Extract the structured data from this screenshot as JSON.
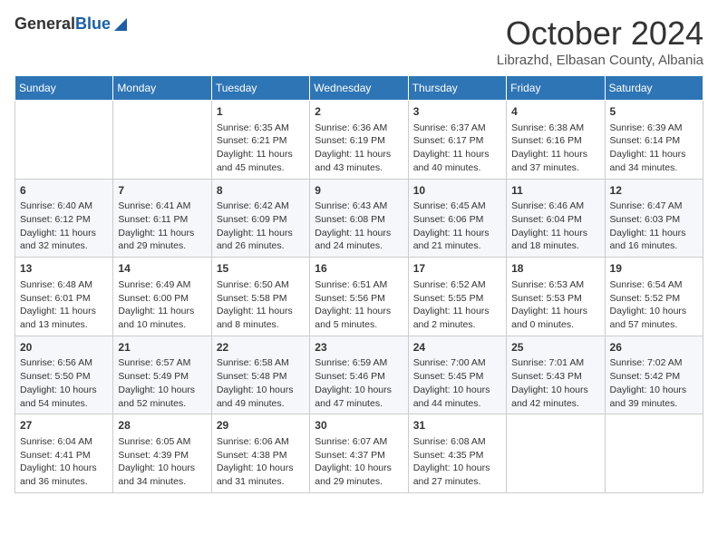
{
  "logo": {
    "general": "General",
    "blue": "Blue"
  },
  "header": {
    "month": "October 2024",
    "location": "Librazhd, Elbasan County, Albania"
  },
  "weekdays": [
    "Sunday",
    "Monday",
    "Tuesday",
    "Wednesday",
    "Thursday",
    "Friday",
    "Saturday"
  ],
  "weeks": [
    [
      {
        "day": null,
        "sunrise": null,
        "sunset": null,
        "daylight": null
      },
      {
        "day": null,
        "sunrise": null,
        "sunset": null,
        "daylight": null
      },
      {
        "day": "1",
        "sunrise": "Sunrise: 6:35 AM",
        "sunset": "Sunset: 6:21 PM",
        "daylight": "Daylight: 11 hours and 45 minutes."
      },
      {
        "day": "2",
        "sunrise": "Sunrise: 6:36 AM",
        "sunset": "Sunset: 6:19 PM",
        "daylight": "Daylight: 11 hours and 43 minutes."
      },
      {
        "day": "3",
        "sunrise": "Sunrise: 6:37 AM",
        "sunset": "Sunset: 6:17 PM",
        "daylight": "Daylight: 11 hours and 40 minutes."
      },
      {
        "day": "4",
        "sunrise": "Sunrise: 6:38 AM",
        "sunset": "Sunset: 6:16 PM",
        "daylight": "Daylight: 11 hours and 37 minutes."
      },
      {
        "day": "5",
        "sunrise": "Sunrise: 6:39 AM",
        "sunset": "Sunset: 6:14 PM",
        "daylight": "Daylight: 11 hours and 34 minutes."
      }
    ],
    [
      {
        "day": "6",
        "sunrise": "Sunrise: 6:40 AM",
        "sunset": "Sunset: 6:12 PM",
        "daylight": "Daylight: 11 hours and 32 minutes."
      },
      {
        "day": "7",
        "sunrise": "Sunrise: 6:41 AM",
        "sunset": "Sunset: 6:11 PM",
        "daylight": "Daylight: 11 hours and 29 minutes."
      },
      {
        "day": "8",
        "sunrise": "Sunrise: 6:42 AM",
        "sunset": "Sunset: 6:09 PM",
        "daylight": "Daylight: 11 hours and 26 minutes."
      },
      {
        "day": "9",
        "sunrise": "Sunrise: 6:43 AM",
        "sunset": "Sunset: 6:08 PM",
        "daylight": "Daylight: 11 hours and 24 minutes."
      },
      {
        "day": "10",
        "sunrise": "Sunrise: 6:45 AM",
        "sunset": "Sunset: 6:06 PM",
        "daylight": "Daylight: 11 hours and 21 minutes."
      },
      {
        "day": "11",
        "sunrise": "Sunrise: 6:46 AM",
        "sunset": "Sunset: 6:04 PM",
        "daylight": "Daylight: 11 hours and 18 minutes."
      },
      {
        "day": "12",
        "sunrise": "Sunrise: 6:47 AM",
        "sunset": "Sunset: 6:03 PM",
        "daylight": "Daylight: 11 hours and 16 minutes."
      }
    ],
    [
      {
        "day": "13",
        "sunrise": "Sunrise: 6:48 AM",
        "sunset": "Sunset: 6:01 PM",
        "daylight": "Daylight: 11 hours and 13 minutes."
      },
      {
        "day": "14",
        "sunrise": "Sunrise: 6:49 AM",
        "sunset": "Sunset: 6:00 PM",
        "daylight": "Daylight: 11 hours and 10 minutes."
      },
      {
        "day": "15",
        "sunrise": "Sunrise: 6:50 AM",
        "sunset": "Sunset: 5:58 PM",
        "daylight": "Daylight: 11 hours and 8 minutes."
      },
      {
        "day": "16",
        "sunrise": "Sunrise: 6:51 AM",
        "sunset": "Sunset: 5:56 PM",
        "daylight": "Daylight: 11 hours and 5 minutes."
      },
      {
        "day": "17",
        "sunrise": "Sunrise: 6:52 AM",
        "sunset": "Sunset: 5:55 PM",
        "daylight": "Daylight: 11 hours and 2 minutes."
      },
      {
        "day": "18",
        "sunrise": "Sunrise: 6:53 AM",
        "sunset": "Sunset: 5:53 PM",
        "daylight": "Daylight: 11 hours and 0 minutes."
      },
      {
        "day": "19",
        "sunrise": "Sunrise: 6:54 AM",
        "sunset": "Sunset: 5:52 PM",
        "daylight": "Daylight: 10 hours and 57 minutes."
      }
    ],
    [
      {
        "day": "20",
        "sunrise": "Sunrise: 6:56 AM",
        "sunset": "Sunset: 5:50 PM",
        "daylight": "Daylight: 10 hours and 54 minutes."
      },
      {
        "day": "21",
        "sunrise": "Sunrise: 6:57 AM",
        "sunset": "Sunset: 5:49 PM",
        "daylight": "Daylight: 10 hours and 52 minutes."
      },
      {
        "day": "22",
        "sunrise": "Sunrise: 6:58 AM",
        "sunset": "Sunset: 5:48 PM",
        "daylight": "Daylight: 10 hours and 49 minutes."
      },
      {
        "day": "23",
        "sunrise": "Sunrise: 6:59 AM",
        "sunset": "Sunset: 5:46 PM",
        "daylight": "Daylight: 10 hours and 47 minutes."
      },
      {
        "day": "24",
        "sunrise": "Sunrise: 7:00 AM",
        "sunset": "Sunset: 5:45 PM",
        "daylight": "Daylight: 10 hours and 44 minutes."
      },
      {
        "day": "25",
        "sunrise": "Sunrise: 7:01 AM",
        "sunset": "Sunset: 5:43 PM",
        "daylight": "Daylight: 10 hours and 42 minutes."
      },
      {
        "day": "26",
        "sunrise": "Sunrise: 7:02 AM",
        "sunset": "Sunset: 5:42 PM",
        "daylight": "Daylight: 10 hours and 39 minutes."
      }
    ],
    [
      {
        "day": "27",
        "sunrise": "Sunrise: 6:04 AM",
        "sunset": "Sunset: 4:41 PM",
        "daylight": "Daylight: 10 hours and 36 minutes."
      },
      {
        "day": "28",
        "sunrise": "Sunrise: 6:05 AM",
        "sunset": "Sunset: 4:39 PM",
        "daylight": "Daylight: 10 hours and 34 minutes."
      },
      {
        "day": "29",
        "sunrise": "Sunrise: 6:06 AM",
        "sunset": "Sunset: 4:38 PM",
        "daylight": "Daylight: 10 hours and 31 minutes."
      },
      {
        "day": "30",
        "sunrise": "Sunrise: 6:07 AM",
        "sunset": "Sunset: 4:37 PM",
        "daylight": "Daylight: 10 hours and 29 minutes."
      },
      {
        "day": "31",
        "sunrise": "Sunrise: 6:08 AM",
        "sunset": "Sunset: 4:35 PM",
        "daylight": "Daylight: 10 hours and 27 minutes."
      },
      {
        "day": null,
        "sunrise": null,
        "sunset": null,
        "daylight": null
      },
      {
        "day": null,
        "sunrise": null,
        "sunset": null,
        "daylight": null
      }
    ]
  ]
}
